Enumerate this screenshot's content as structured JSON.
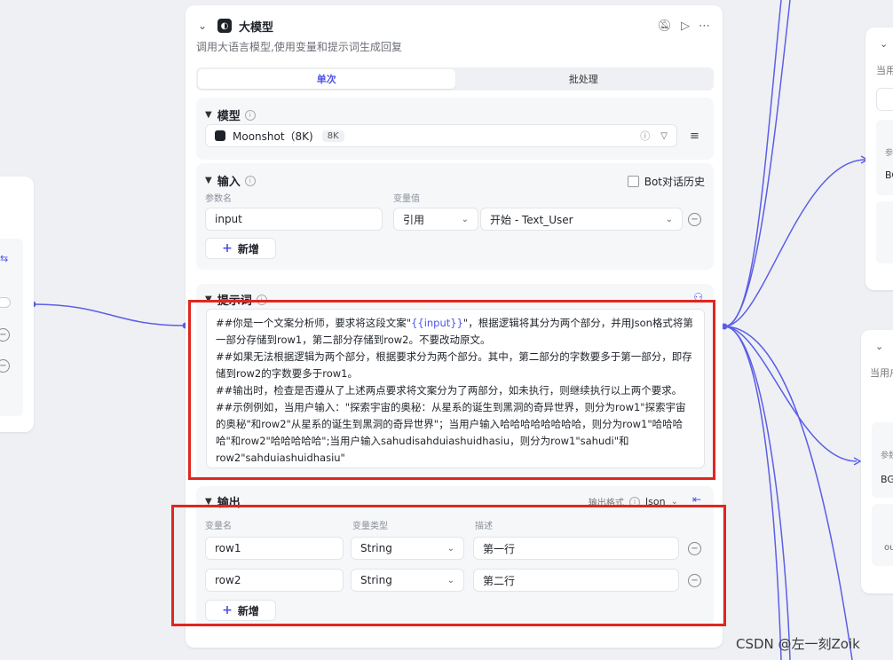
{
  "node": {
    "title": "大模型",
    "description": "调用大语言模型,使用变量和提示词生成回复",
    "tabs": [
      "单次",
      "批处理"
    ]
  },
  "model": {
    "section_title": "模型",
    "name": "Moonshot（8K)",
    "badge": "8K"
  },
  "input": {
    "section_title": "输入",
    "history_label": "Bot对话历史",
    "col_param": "参数名",
    "col_value": "变量值",
    "param_name": "input",
    "ref_type": "引用",
    "ref_value": "开始 - Text_User",
    "add_label": "新增"
  },
  "prompt": {
    "section_title": "提示词",
    "line1a": "##你是一个文案分析师，要求将这段文案\"",
    "var": "{{input}}",
    "line1b": "\"，根据逻辑将其分为两个部分，并用Json格式将第一部分存储到row1，第二部分存储到row2。不要改动原文。",
    "line2": "##如果无法根据逻辑为两个部分，根据要求分为两个部分。其中，第二部分的字数要多于第一部分，即存储到row2的字数要多于row1。",
    "line3": "##输出时，检查是否遵从了上述两点要求将文案分为了两部分，如未执行，则继续执行以上两个要求。",
    "line4": "##示例例如，当用户输入：\"探索宇宙的奥秘：从星系的诞生到黑洞的奇异世界，则分为row1\"探索宇宙的奥秘\"和row2\"从星系的诞生到黑洞的奇异世界\"；当用户输入哈哈哈哈哈哈哈哈，则分为row1\"哈哈哈哈\"和row2\"哈哈哈哈哈\";当用户输入sahudisahduiashuidhasiu，则分为row1\"sahudi\"和row2\"sahduiashuidhasiu\""
  },
  "output": {
    "section_title": "输出",
    "format_label": "输出格式",
    "format_value": "Json",
    "col_name": "变量名",
    "col_type": "变量类型",
    "col_desc": "描述",
    "rows": [
      {
        "name": "row1",
        "type": "String",
        "desc": "第一行"
      },
      {
        "name": "row2",
        "type": "String",
        "desc": "第二行"
      }
    ],
    "add_label": "新增"
  },
  "right_panel": {
    "top_text": "当用",
    "top_param": "参",
    "top_value": "BG",
    "bottom_text": "当用户",
    "bottom_param": "参数",
    "bottom_value": "BG",
    "bottom_extra": "ou"
  },
  "watermark": "CSDN @左一刻Zoik",
  "colors": {
    "accent": "#4d53e8",
    "highlight_box": "#e0261f",
    "edge": "#5b5fe6"
  }
}
